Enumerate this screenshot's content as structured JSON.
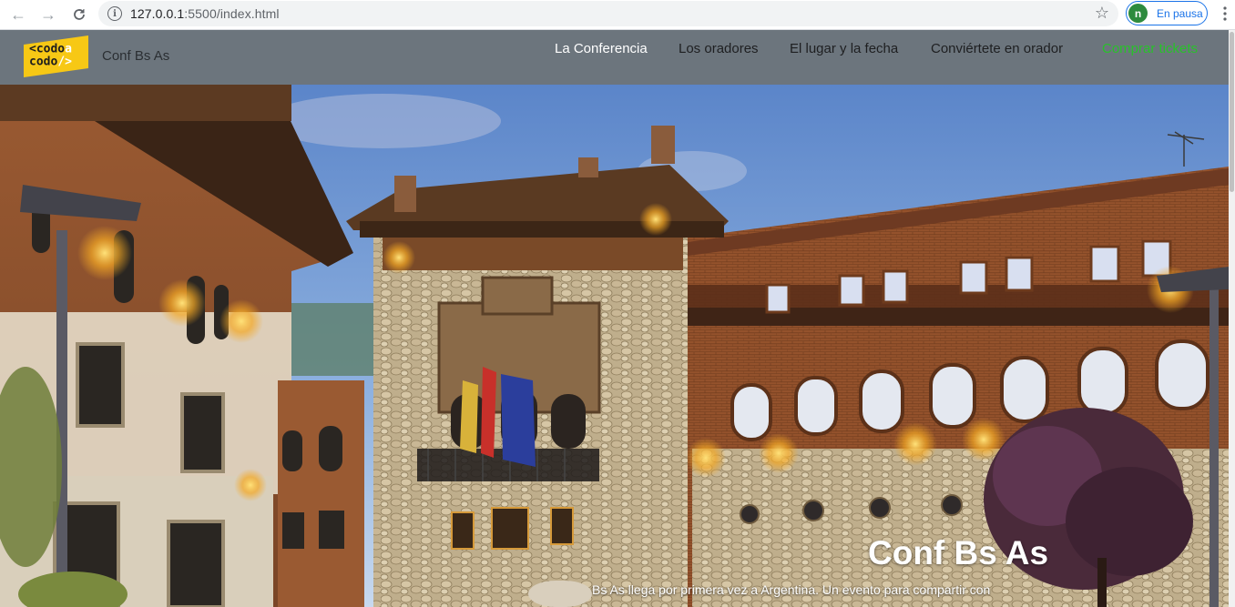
{
  "browser": {
    "back_icon": "arrow-left-icon",
    "forward_icon": "arrow-right-icon",
    "reload_icon": "reload-icon",
    "url_host": "127.0.0.1",
    "url_rest": ":5500/index.html",
    "bookmark_icon": "star-icon",
    "profile_initial": "n",
    "profile_status": "En pausa",
    "profile_color": "#2e8b3e",
    "accent": "#1a73e8"
  },
  "navbar": {
    "logo_line1": "<codo",
    "logo_line1_suffix": "a",
    "logo_line2": "codo",
    "logo_line2_suffix": "/>",
    "brand": "Conf Bs As",
    "background": "#6c757d",
    "links": [
      {
        "label": "La Conferencia",
        "state": "active"
      },
      {
        "label": "Los oradores",
        "state": "normal"
      },
      {
        "label": "El lugar y la fecha",
        "state": "normal"
      },
      {
        "label": "Conviértete en orador",
        "state": "normal"
      },
      {
        "label": "Comprar tickets",
        "state": "highlight",
        "color": "#28c22a"
      }
    ]
  },
  "hero": {
    "title": "Conf Bs As",
    "subtitle": "Bs As llega por primera vez a Argentina. Un evento para compartir con"
  }
}
